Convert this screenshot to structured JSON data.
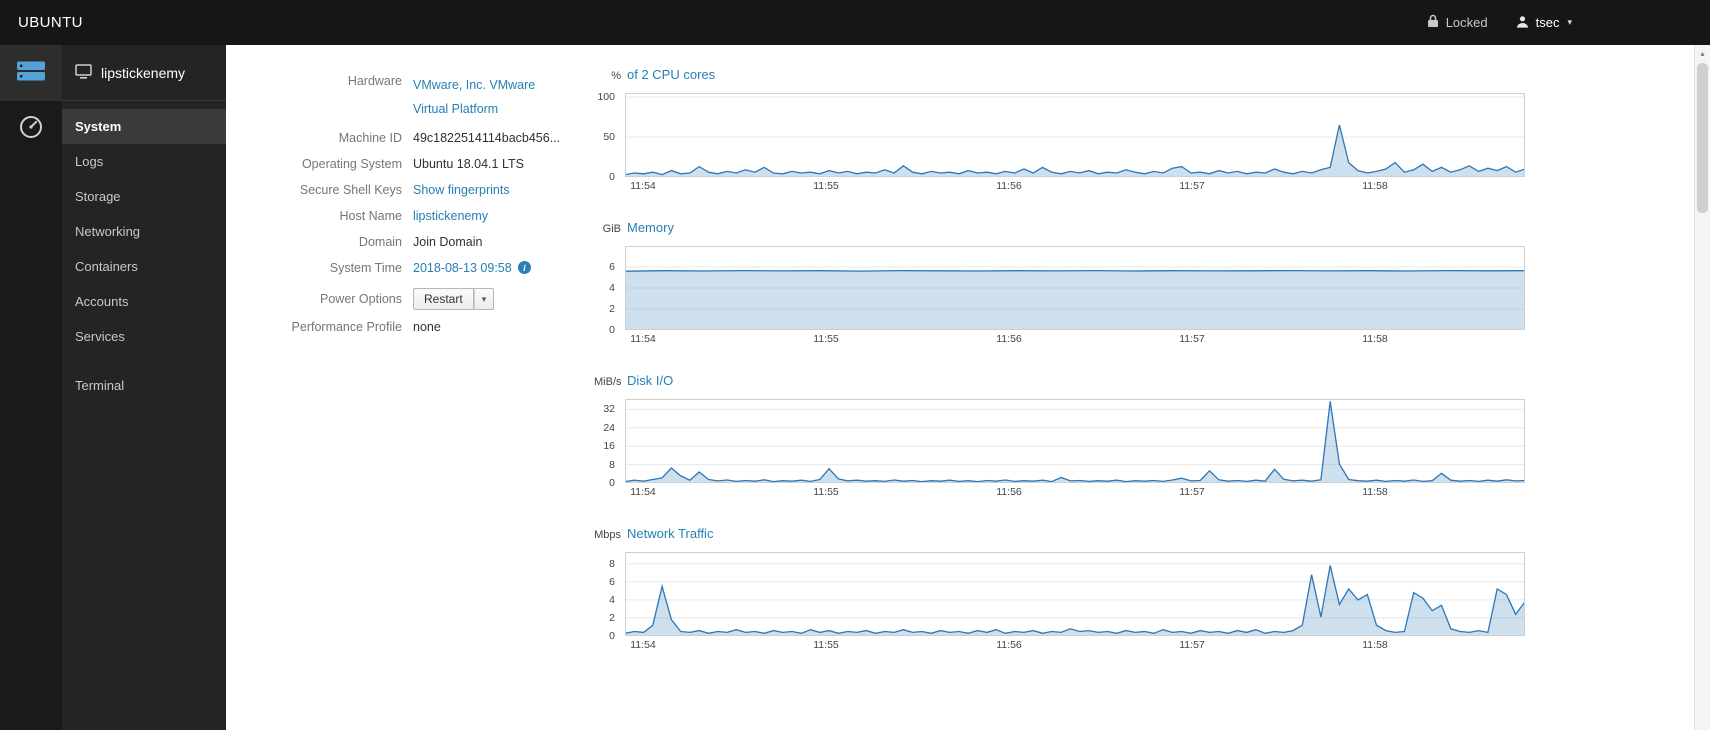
{
  "topbar": {
    "brand": "UBUNTU",
    "locked_label": "Locked",
    "user_label": "tsec"
  },
  "sidebar": {
    "hostname": "lipstickenemy",
    "items": [
      {
        "label": "System",
        "active": true,
        "separated": false
      },
      {
        "label": "Logs",
        "active": false,
        "separated": false
      },
      {
        "label": "Storage",
        "active": false,
        "separated": false
      },
      {
        "label": "Networking",
        "active": false,
        "separated": false
      },
      {
        "label": "Containers",
        "active": false,
        "separated": false
      },
      {
        "label": "Accounts",
        "active": false,
        "separated": false
      },
      {
        "label": "Services",
        "active": false,
        "separated": false
      },
      {
        "label": "Terminal",
        "active": false,
        "separated": true
      }
    ]
  },
  "system_info": {
    "rows": [
      {
        "key": "hardware",
        "label": "Hardware",
        "value": "VMware, Inc. VMware Virtual Platform",
        "type": "link",
        "wrap": true
      },
      {
        "key": "machine-id",
        "label": "Machine ID",
        "value": "49c1822514114bacb456...",
        "type": "text",
        "wrap": false
      },
      {
        "key": "operating-system",
        "label": "Operating System",
        "value": "Ubuntu 18.04.1 LTS",
        "type": "text",
        "wrap": false
      },
      {
        "key": "secure-shell-keys",
        "label": "Secure Shell Keys",
        "value": "Show fingerprints",
        "type": "link",
        "wrap": false
      },
      {
        "key": "host-name",
        "label": "Host Name",
        "value": "lipstickenemy",
        "type": "link",
        "wrap": false
      },
      {
        "key": "domain",
        "label": "Domain",
        "value": "Join Domain",
        "type": "text",
        "wrap": false
      },
      {
        "key": "system-time",
        "label": "System Time",
        "value": "2018-08-13 09:58",
        "type": "link-info",
        "wrap": false
      },
      {
        "key": "power-options",
        "label": "Power Options",
        "value": "Restart",
        "type": "button",
        "wrap": false
      },
      {
        "key": "performance-profile",
        "label": "Performance Profile",
        "value": "none",
        "type": "text",
        "wrap": false
      }
    ]
  },
  "colors": {
    "accent": "#267fb5",
    "line": "#2b77b8",
    "fill": "rgba(59,130,189,0.25)",
    "grid": "#e8e8e8",
    "border": "#cfcfcf"
  },
  "icons": {
    "lock-icon": "padlock",
    "user-icon": "person silhouette",
    "chevron-down-icon": "▾",
    "server-icon": "blue server stack",
    "dashboard-icon": "gauge dial",
    "host-icon": "monitor outline",
    "info-icon": "blue circled i",
    "scroll-up-icon": "▴"
  },
  "chart_data": [
    {
      "id": "cpu",
      "type": "area",
      "unit": "%",
      "title": "of 2 CPU cores",
      "ylim": [
        0,
        105
      ],
      "yticks": [
        0,
        50,
        100
      ],
      "x_labels": [
        "11:54",
        "11:55",
        "11:56",
        "11:57",
        "11:58"
      ],
      "values": [
        3,
        5,
        4,
        6,
        3,
        8,
        4,
        5,
        13,
        6,
        4,
        7,
        5,
        9,
        6,
        12,
        5,
        4,
        7,
        5,
        6,
        4,
        8,
        5,
        7,
        4,
        6,
        5,
        9,
        5,
        14,
        6,
        4,
        7,
        5,
        6,
        4,
        8,
        5,
        6,
        4,
        7,
        5,
        10,
        5,
        12,
        6,
        4,
        7,
        5,
        8,
        4,
        6,
        5,
        9,
        6,
        4,
        7,
        5,
        11,
        13,
        5,
        6,
        4,
        8,
        5,
        7,
        4,
        6,
        5,
        10,
        6,
        4,
        7,
        5,
        9,
        12,
        65,
        18,
        8,
        5,
        7,
        10,
        18,
        6,
        9,
        16,
        7,
        12,
        6,
        9,
        14,
        7,
        11,
        8,
        13,
        6,
        10
      ]
    },
    {
      "id": "memory",
      "type": "area",
      "unit": "GiB",
      "title": "Memory",
      "ylim": [
        0,
        8
      ],
      "yticks": [
        0,
        2,
        4,
        6
      ],
      "x_labels": [
        "11:54",
        "11:55",
        "11:56",
        "11:57",
        "11:58"
      ],
      "values": [
        5.6,
        5.65,
        5.62,
        5.66,
        5.63,
        5.65,
        5.61,
        5.66,
        5.64,
        5.62,
        5.65,
        5.63,
        5.66,
        5.62,
        5.65,
        5.63,
        5.64,
        5.66,
        5.63,
        5.65,
        5.62,
        5.66,
        5.64,
        5.65
      ]
    },
    {
      "id": "disk",
      "type": "area",
      "unit": "MiB/s",
      "title": "Disk I/O",
      "ylim": [
        0,
        36.5
      ],
      "yticks": [
        0,
        8,
        16,
        24,
        32
      ],
      "x_labels": [
        "11:54",
        "11:55",
        "11:56",
        "11:57",
        "11:58"
      ],
      "values": [
        0.6,
        1.2,
        0.8,
        1.5,
        2.2,
        6.5,
        3.1,
        1.2,
        4.8,
        1.5,
        0.9,
        1.3,
        0.7,
        1.1,
        0.8,
        1.4,
        0.6,
        1.0,
        0.8,
        1.2,
        0.7,
        1.5,
        6.2,
        1.8,
        0.9,
        1.2,
        0.8,
        1.0,
        0.7,
        1.3,
        0.8,
        1.1,
        0.6,
        1.0,
        0.8,
        1.2,
        0.7,
        1.0,
        0.6,
        1.1,
        0.8,
        1.3,
        0.7,
        1.0,
        0.8,
        1.2,
        0.6,
        2.4,
        0.9,
        1.1,
        0.7,
        1.0,
        0.8,
        1.2,
        0.6,
        1.0,
        0.8,
        1.1,
        0.7,
        1.3,
        2.1,
        0.9,
        1.1,
        5.3,
        1.4,
        0.8,
        1.1,
        0.7,
        1.2,
        0.8,
        6.0,
        1.6,
        0.9,
        1.2,
        0.8,
        1.4,
        35.5,
        8.2,
        1.5,
        1.0,
        0.8,
        1.2,
        0.7,
        1.1,
        0.8,
        1.3,
        0.7,
        1.0,
        4.2,
        1.2,
        0.8,
        1.1,
        0.7,
        1.2,
        0.8,
        1.4,
        0.9,
        1.1
      ]
    },
    {
      "id": "network",
      "type": "area",
      "unit": "Mbps",
      "title": "Network Traffic",
      "ylim": [
        0,
        9.3
      ],
      "yticks": [
        0,
        2,
        4,
        6,
        8
      ],
      "x_labels": [
        "11:54",
        "11:55",
        "11:56",
        "11:57",
        "11:58"
      ],
      "values": [
        0.3,
        0.5,
        0.4,
        1.2,
        5.5,
        1.8,
        0.5,
        0.4,
        0.6,
        0.3,
        0.5,
        0.4,
        0.7,
        0.4,
        0.5,
        0.3,
        0.6,
        0.4,
        0.5,
        0.3,
        0.7,
        0.4,
        0.6,
        0.3,
        0.5,
        0.4,
        0.6,
        0.3,
        0.5,
        0.4,
        0.7,
        0.4,
        0.5,
        0.3,
        0.6,
        0.4,
        0.5,
        0.3,
        0.6,
        0.4,
        0.7,
        0.3,
        0.5,
        0.4,
        0.6,
        0.3,
        0.5,
        0.4,
        0.8,
        0.5,
        0.6,
        0.4,
        0.5,
        0.3,
        0.6,
        0.4,
        0.5,
        0.3,
        0.7,
        0.4,
        0.5,
        0.3,
        0.6,
        0.4,
        0.5,
        0.3,
        0.6,
        0.4,
        0.7,
        0.3,
        0.5,
        0.4,
        0.6,
        1.2,
        6.8,
        2.1,
        7.8,
        3.5,
        5.2,
        4.0,
        4.6,
        1.2,
        0.6,
        0.4,
        0.5,
        4.8,
        4.2,
        2.8,
        3.4,
        0.8,
        0.5,
        0.4,
        0.6,
        0.4,
        5.2,
        4.6,
        2.4,
        3.8
      ]
    }
  ]
}
